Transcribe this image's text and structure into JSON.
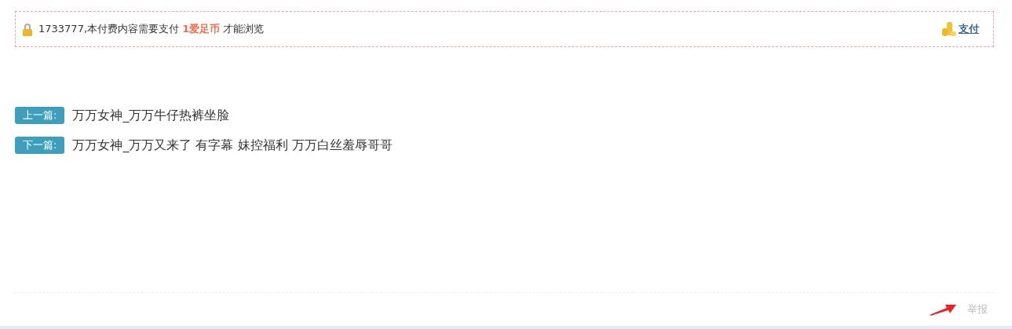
{
  "paywall": {
    "text": "1733777,本付费内容需要支付 **1爱足币** 才能浏览",
    "pay_link": "支付"
  },
  "post_nav": [
    {
      "label": "上一篇:",
      "title": "万万女神_万万牛仔热裤坐脸"
    },
    {
      "label": "下一篇:",
      "title": "万万女神_万万又来了 有字幕 妹控福利 万万白丝羞辱哥哥"
    }
  ],
  "report_link": "举报"
}
